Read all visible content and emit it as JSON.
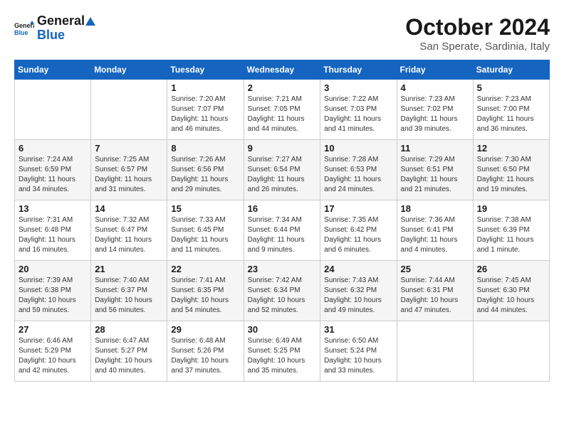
{
  "header": {
    "logo_line1": "General",
    "logo_line2": "Blue",
    "title": "October 2024",
    "subtitle": "San Sperate, Sardinia, Italy"
  },
  "columns": [
    "Sunday",
    "Monday",
    "Tuesday",
    "Wednesday",
    "Thursday",
    "Friday",
    "Saturday"
  ],
  "weeks": [
    [
      {
        "day": "",
        "info": ""
      },
      {
        "day": "",
        "info": ""
      },
      {
        "day": "1",
        "info": "Sunrise: 7:20 AM\nSunset: 7:07 PM\nDaylight: 11 hours and 46 minutes."
      },
      {
        "day": "2",
        "info": "Sunrise: 7:21 AM\nSunset: 7:05 PM\nDaylight: 11 hours and 44 minutes."
      },
      {
        "day": "3",
        "info": "Sunrise: 7:22 AM\nSunset: 7:03 PM\nDaylight: 11 hours and 41 minutes."
      },
      {
        "day": "4",
        "info": "Sunrise: 7:23 AM\nSunset: 7:02 PM\nDaylight: 11 hours and 39 minutes."
      },
      {
        "day": "5",
        "info": "Sunrise: 7:23 AM\nSunset: 7:00 PM\nDaylight: 11 hours and 36 minutes."
      }
    ],
    [
      {
        "day": "6",
        "info": "Sunrise: 7:24 AM\nSunset: 6:59 PM\nDaylight: 11 hours and 34 minutes."
      },
      {
        "day": "7",
        "info": "Sunrise: 7:25 AM\nSunset: 6:57 PM\nDaylight: 11 hours and 31 minutes."
      },
      {
        "day": "8",
        "info": "Sunrise: 7:26 AM\nSunset: 6:56 PM\nDaylight: 11 hours and 29 minutes."
      },
      {
        "day": "9",
        "info": "Sunrise: 7:27 AM\nSunset: 6:54 PM\nDaylight: 11 hours and 26 minutes."
      },
      {
        "day": "10",
        "info": "Sunrise: 7:28 AM\nSunset: 6:53 PM\nDaylight: 11 hours and 24 minutes."
      },
      {
        "day": "11",
        "info": "Sunrise: 7:29 AM\nSunset: 6:51 PM\nDaylight: 11 hours and 21 minutes."
      },
      {
        "day": "12",
        "info": "Sunrise: 7:30 AM\nSunset: 6:50 PM\nDaylight: 11 hours and 19 minutes."
      }
    ],
    [
      {
        "day": "13",
        "info": "Sunrise: 7:31 AM\nSunset: 6:48 PM\nDaylight: 11 hours and 16 minutes."
      },
      {
        "day": "14",
        "info": "Sunrise: 7:32 AM\nSunset: 6:47 PM\nDaylight: 11 hours and 14 minutes."
      },
      {
        "day": "15",
        "info": "Sunrise: 7:33 AM\nSunset: 6:45 PM\nDaylight: 11 hours and 11 minutes."
      },
      {
        "day": "16",
        "info": "Sunrise: 7:34 AM\nSunset: 6:44 PM\nDaylight: 11 hours and 9 minutes."
      },
      {
        "day": "17",
        "info": "Sunrise: 7:35 AM\nSunset: 6:42 PM\nDaylight: 11 hours and 6 minutes."
      },
      {
        "day": "18",
        "info": "Sunrise: 7:36 AM\nSunset: 6:41 PM\nDaylight: 11 hours and 4 minutes."
      },
      {
        "day": "19",
        "info": "Sunrise: 7:38 AM\nSunset: 6:39 PM\nDaylight: 11 hours and 1 minute."
      }
    ],
    [
      {
        "day": "20",
        "info": "Sunrise: 7:39 AM\nSunset: 6:38 PM\nDaylight: 10 hours and 59 minutes."
      },
      {
        "day": "21",
        "info": "Sunrise: 7:40 AM\nSunset: 6:37 PM\nDaylight: 10 hours and 56 minutes."
      },
      {
        "day": "22",
        "info": "Sunrise: 7:41 AM\nSunset: 6:35 PM\nDaylight: 10 hours and 54 minutes."
      },
      {
        "day": "23",
        "info": "Sunrise: 7:42 AM\nSunset: 6:34 PM\nDaylight: 10 hours and 52 minutes."
      },
      {
        "day": "24",
        "info": "Sunrise: 7:43 AM\nSunset: 6:32 PM\nDaylight: 10 hours and 49 minutes."
      },
      {
        "day": "25",
        "info": "Sunrise: 7:44 AM\nSunset: 6:31 PM\nDaylight: 10 hours and 47 minutes."
      },
      {
        "day": "26",
        "info": "Sunrise: 7:45 AM\nSunset: 6:30 PM\nDaylight: 10 hours and 44 minutes."
      }
    ],
    [
      {
        "day": "27",
        "info": "Sunrise: 6:46 AM\nSunset: 5:29 PM\nDaylight: 10 hours and 42 minutes."
      },
      {
        "day": "28",
        "info": "Sunrise: 6:47 AM\nSunset: 5:27 PM\nDaylight: 10 hours and 40 minutes."
      },
      {
        "day": "29",
        "info": "Sunrise: 6:48 AM\nSunset: 5:26 PM\nDaylight: 10 hours and 37 minutes."
      },
      {
        "day": "30",
        "info": "Sunrise: 6:49 AM\nSunset: 5:25 PM\nDaylight: 10 hours and 35 minutes."
      },
      {
        "day": "31",
        "info": "Sunrise: 6:50 AM\nSunset: 5:24 PM\nDaylight: 10 hours and 33 minutes."
      },
      {
        "day": "",
        "info": ""
      },
      {
        "day": "",
        "info": ""
      }
    ]
  ]
}
